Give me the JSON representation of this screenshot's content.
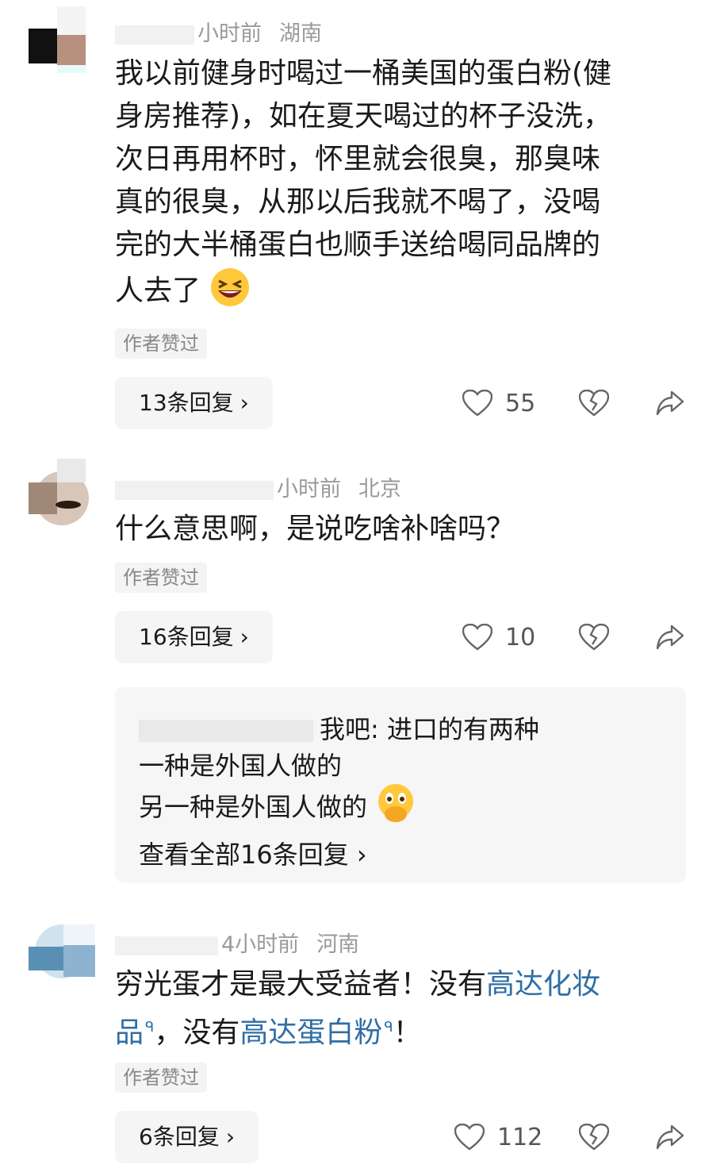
{
  "comments": [
    {
      "meta_time": "小时前",
      "meta_loc": "湖南",
      "text_lines": [
        "我以前健身时喝过一桶美国的蛋白粉(健",
        "身房推荐)，如在夏天喝过的杯子没洗，",
        "次日再用杯时，怀里就会很臭，那臭味",
        "真的很臭，从那以后我就不喝了，没喝",
        "完的大半桶蛋白也顺手送给喝同品牌的",
        "人去了"
      ],
      "emoji": "laughing-face",
      "tag": "作者赞过",
      "replies": "13条回复",
      "likes": "55"
    },
    {
      "meta_time": "小时前",
      "meta_loc": "北京",
      "text": "什么意思啊，是说吃啥补啥吗？",
      "tag": "作者赞过",
      "replies": "16条回复",
      "likes": "10",
      "preview": {
        "line1": "我吧: 进口的有两种",
        "line2": "一种是外国人做的",
        "line3": "另一种是外国人做的",
        "emoji": "hand-over-mouth-face",
        "view_all": "查看全部16条回复"
      }
    },
    {
      "meta_time": "4小时前",
      "meta_loc": "河南",
      "text_a": "穷光蛋才是最大受益者！没有",
      "link1_a": "高达化妆",
      "link1_b": "品",
      "text_b": "，没有",
      "link2": "高达蛋白粉",
      "text_c": "！",
      "tag": "作者赞过",
      "replies": "6条回复",
      "likes": "112"
    }
  ],
  "colors": {
    "link": "#2f6ea5",
    "meta": "#9a9a9a",
    "button_bg": "#f5f5f5"
  },
  "icons": [
    "heart-icon",
    "broken-heart-icon",
    "share-icon",
    "chevron-right-icon",
    "search-superscript-icon"
  ]
}
